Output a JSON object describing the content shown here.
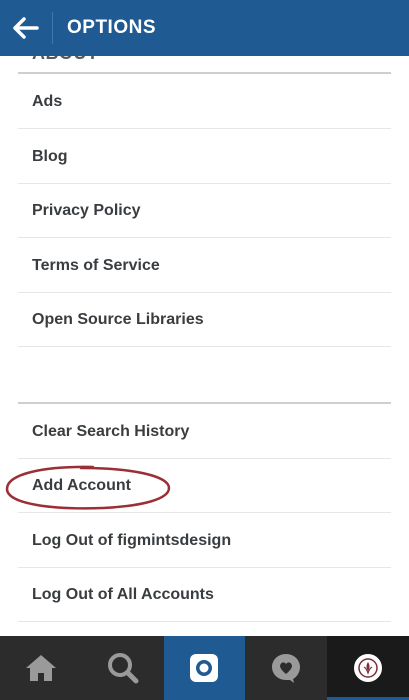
{
  "header": {
    "title": "OPTIONS",
    "back_icon": "arrow-left-icon"
  },
  "section_about": {
    "title": "ABOUT"
  },
  "about_items": [
    {
      "label": "Ads"
    },
    {
      "label": "Blog"
    },
    {
      "label": "Privacy Policy"
    },
    {
      "label": "Terms of Service"
    },
    {
      "label": "Open Source Libraries"
    }
  ],
  "account_items": [
    {
      "label": "Clear Search History"
    },
    {
      "label": "Add Account"
    },
    {
      "label": "Log Out of figmintsdesign"
    },
    {
      "label": "Log Out of All Accounts"
    }
  ],
  "bottom_nav": {
    "items": [
      {
        "name": "home",
        "icon": "home-icon"
      },
      {
        "name": "search",
        "icon": "search-icon"
      },
      {
        "name": "camera",
        "icon": "camera-icon",
        "active": true
      },
      {
        "name": "activity",
        "icon": "heart-bubble-icon"
      },
      {
        "name": "profile",
        "icon": "avatar"
      }
    ]
  },
  "colors": {
    "header": "#1f5a93",
    "nav_background": "#2c2c2c",
    "annotation": "#9b2f36",
    "text": "#3a3d40"
  }
}
